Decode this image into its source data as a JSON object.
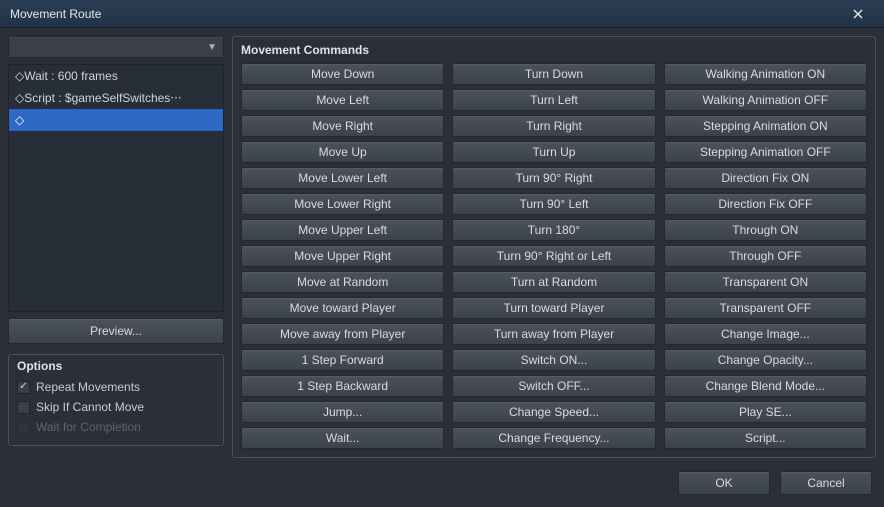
{
  "window": {
    "title": "Movement Route"
  },
  "target": {
    "selected": ""
  },
  "route": {
    "items": [
      {
        "text": "◇Wait : 600 frames",
        "selected": false
      },
      {
        "text": "◇Script : $gameSelfSwitches‧‧‧",
        "selected": false
      },
      {
        "text": "◇",
        "selected": true
      }
    ]
  },
  "preview": {
    "label": "Preview..."
  },
  "options": {
    "title": "Options",
    "repeat": {
      "label": "Repeat Movements",
      "checked": true,
      "enabled": true
    },
    "skip": {
      "label": "Skip If Cannot Move",
      "checked": false,
      "enabled": true
    },
    "wait": {
      "label": "Wait for Completion",
      "checked": false,
      "enabled": false
    }
  },
  "commands": {
    "title": "Movement Commands",
    "col1": [
      "Move Down",
      "Move Left",
      "Move Right",
      "Move Up",
      "Move Lower Left",
      "Move Lower Right",
      "Move Upper Left",
      "Move Upper Right",
      "Move at Random",
      "Move toward Player",
      "Move away from Player",
      "1 Step Forward",
      "1 Step Backward",
      "Jump...",
      "Wait..."
    ],
    "col2": [
      "Turn Down",
      "Turn Left",
      "Turn Right",
      "Turn Up",
      "Turn 90° Right",
      "Turn 90° Left",
      "Turn 180°",
      "Turn 90° Right or Left",
      "Turn at Random",
      "Turn toward Player",
      "Turn away from Player",
      "Switch ON...",
      "Switch OFF...",
      "Change Speed...",
      "Change Frequency..."
    ],
    "col3": [
      "Walking Animation ON",
      "Walking Animation OFF",
      "Stepping Animation ON",
      "Stepping Animation OFF",
      "Direction Fix ON",
      "Direction Fix OFF",
      "Through ON",
      "Through OFF",
      "Transparent ON",
      "Transparent OFF",
      "Change Image...",
      "Change Opacity...",
      "Change Blend Mode...",
      "Play SE...",
      "Script..."
    ]
  },
  "footer": {
    "ok": "OK",
    "cancel": "Cancel"
  }
}
